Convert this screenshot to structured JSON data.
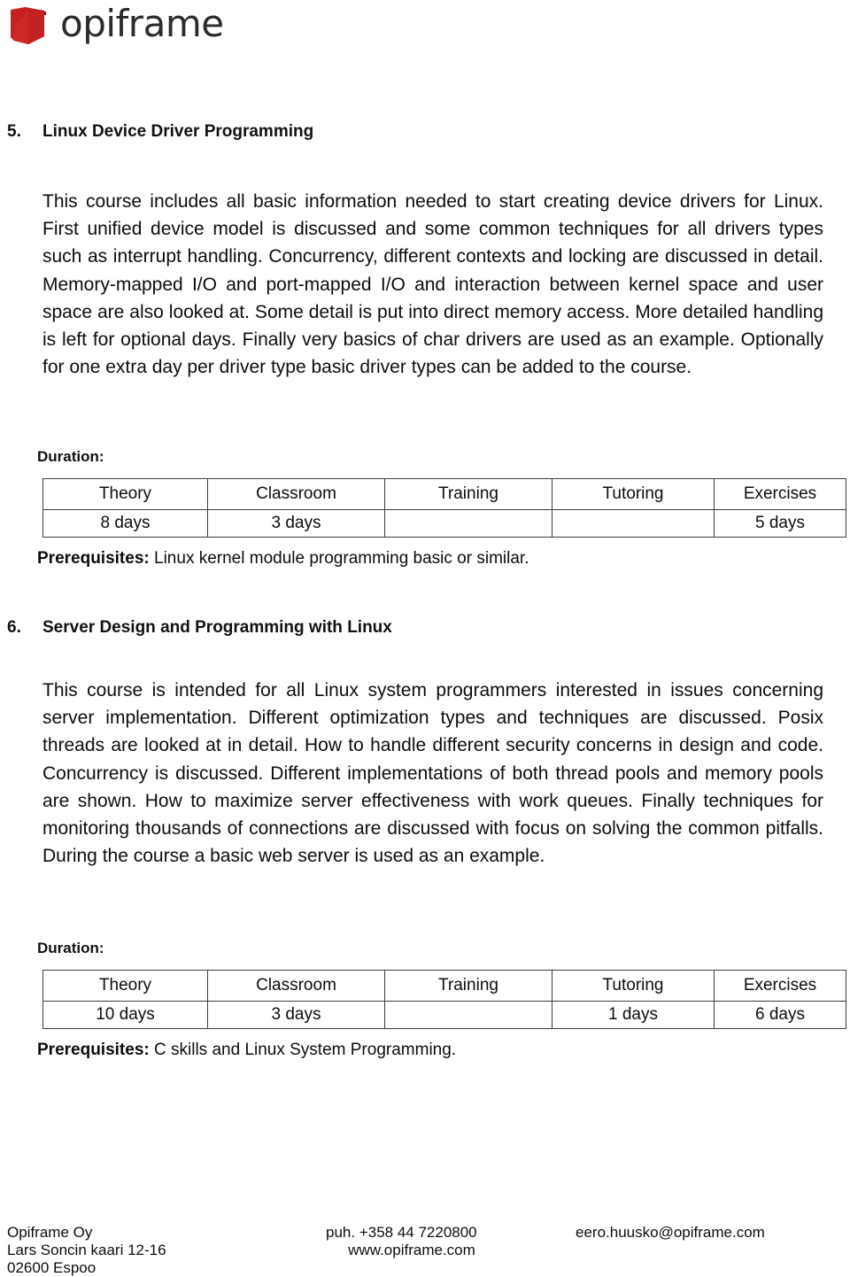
{
  "header": {
    "logo_icon": "book-logo-icon",
    "logo_text": "opiframe",
    "logo_color": "#C62020"
  },
  "sections": [
    {
      "number": "5.",
      "title": "Linux Device Driver Programming",
      "body": "This course includes all basic information needed to start creating device drivers for Linux. First unified device model is discussed and some common techniques for all drivers types such as interrupt handling. Concurrency, different contexts and locking are discussed in detail. Memory-mapped I/O and port-mapped I/O and interaction between kernel space and user space are also looked at. Some detail is put into direct memory access. More detailed handling is left for optional days. Finally very basics of char drivers are used as an example. Optionally for one extra day per driver type basic driver types can be added to the course.",
      "duration_label": "Duration:",
      "table": {
        "headers": [
          "Theory",
          "Classroom",
          "Training",
          "Tutoring",
          "Exercises"
        ],
        "values": [
          "8 days",
          "3 days",
          "",
          "",
          "5 days"
        ]
      },
      "prerequisites_label": "Prerequisites:",
      "prerequisites_text": "Linux kernel module programming basic or similar."
    },
    {
      "number": "6.",
      "title": "Server Design and Programming with Linux",
      "body": "This course is intended for all Linux system programmers interested in issues concerning server implementation. Different optimization types and techniques are discussed. Posix threads are looked at in detail. How to handle different security concerns in design and code. Concurrency is discussed. Different implementations of both thread pools and memory pools are shown. How to maximize server effectiveness with work queues. Finally techniques for monitoring thousands of connections are discussed with focus on solving the common pitfalls. During the course a basic web server is used as an example.",
      "duration_label": "Duration:",
      "table": {
        "headers": [
          "Theory",
          "Classroom",
          "Training",
          "Tutoring",
          "Exercises"
        ],
        "values": [
          "10  days",
          "3 days",
          "",
          "1 days",
          "6 days"
        ]
      },
      "prerequisites_label": "Prerequisites:",
      "prerequisites_text": "C skills and Linux System Programming."
    }
  ],
  "footer": {
    "company": "Opiframe Oy",
    "street": "Lars Soncin kaari 12-16",
    "city": "02600 Espoo",
    "phone": "puh. +358  44 7220800",
    "website": "www.opiframe.com",
    "email": "eero.huusko@opiframe.com"
  }
}
